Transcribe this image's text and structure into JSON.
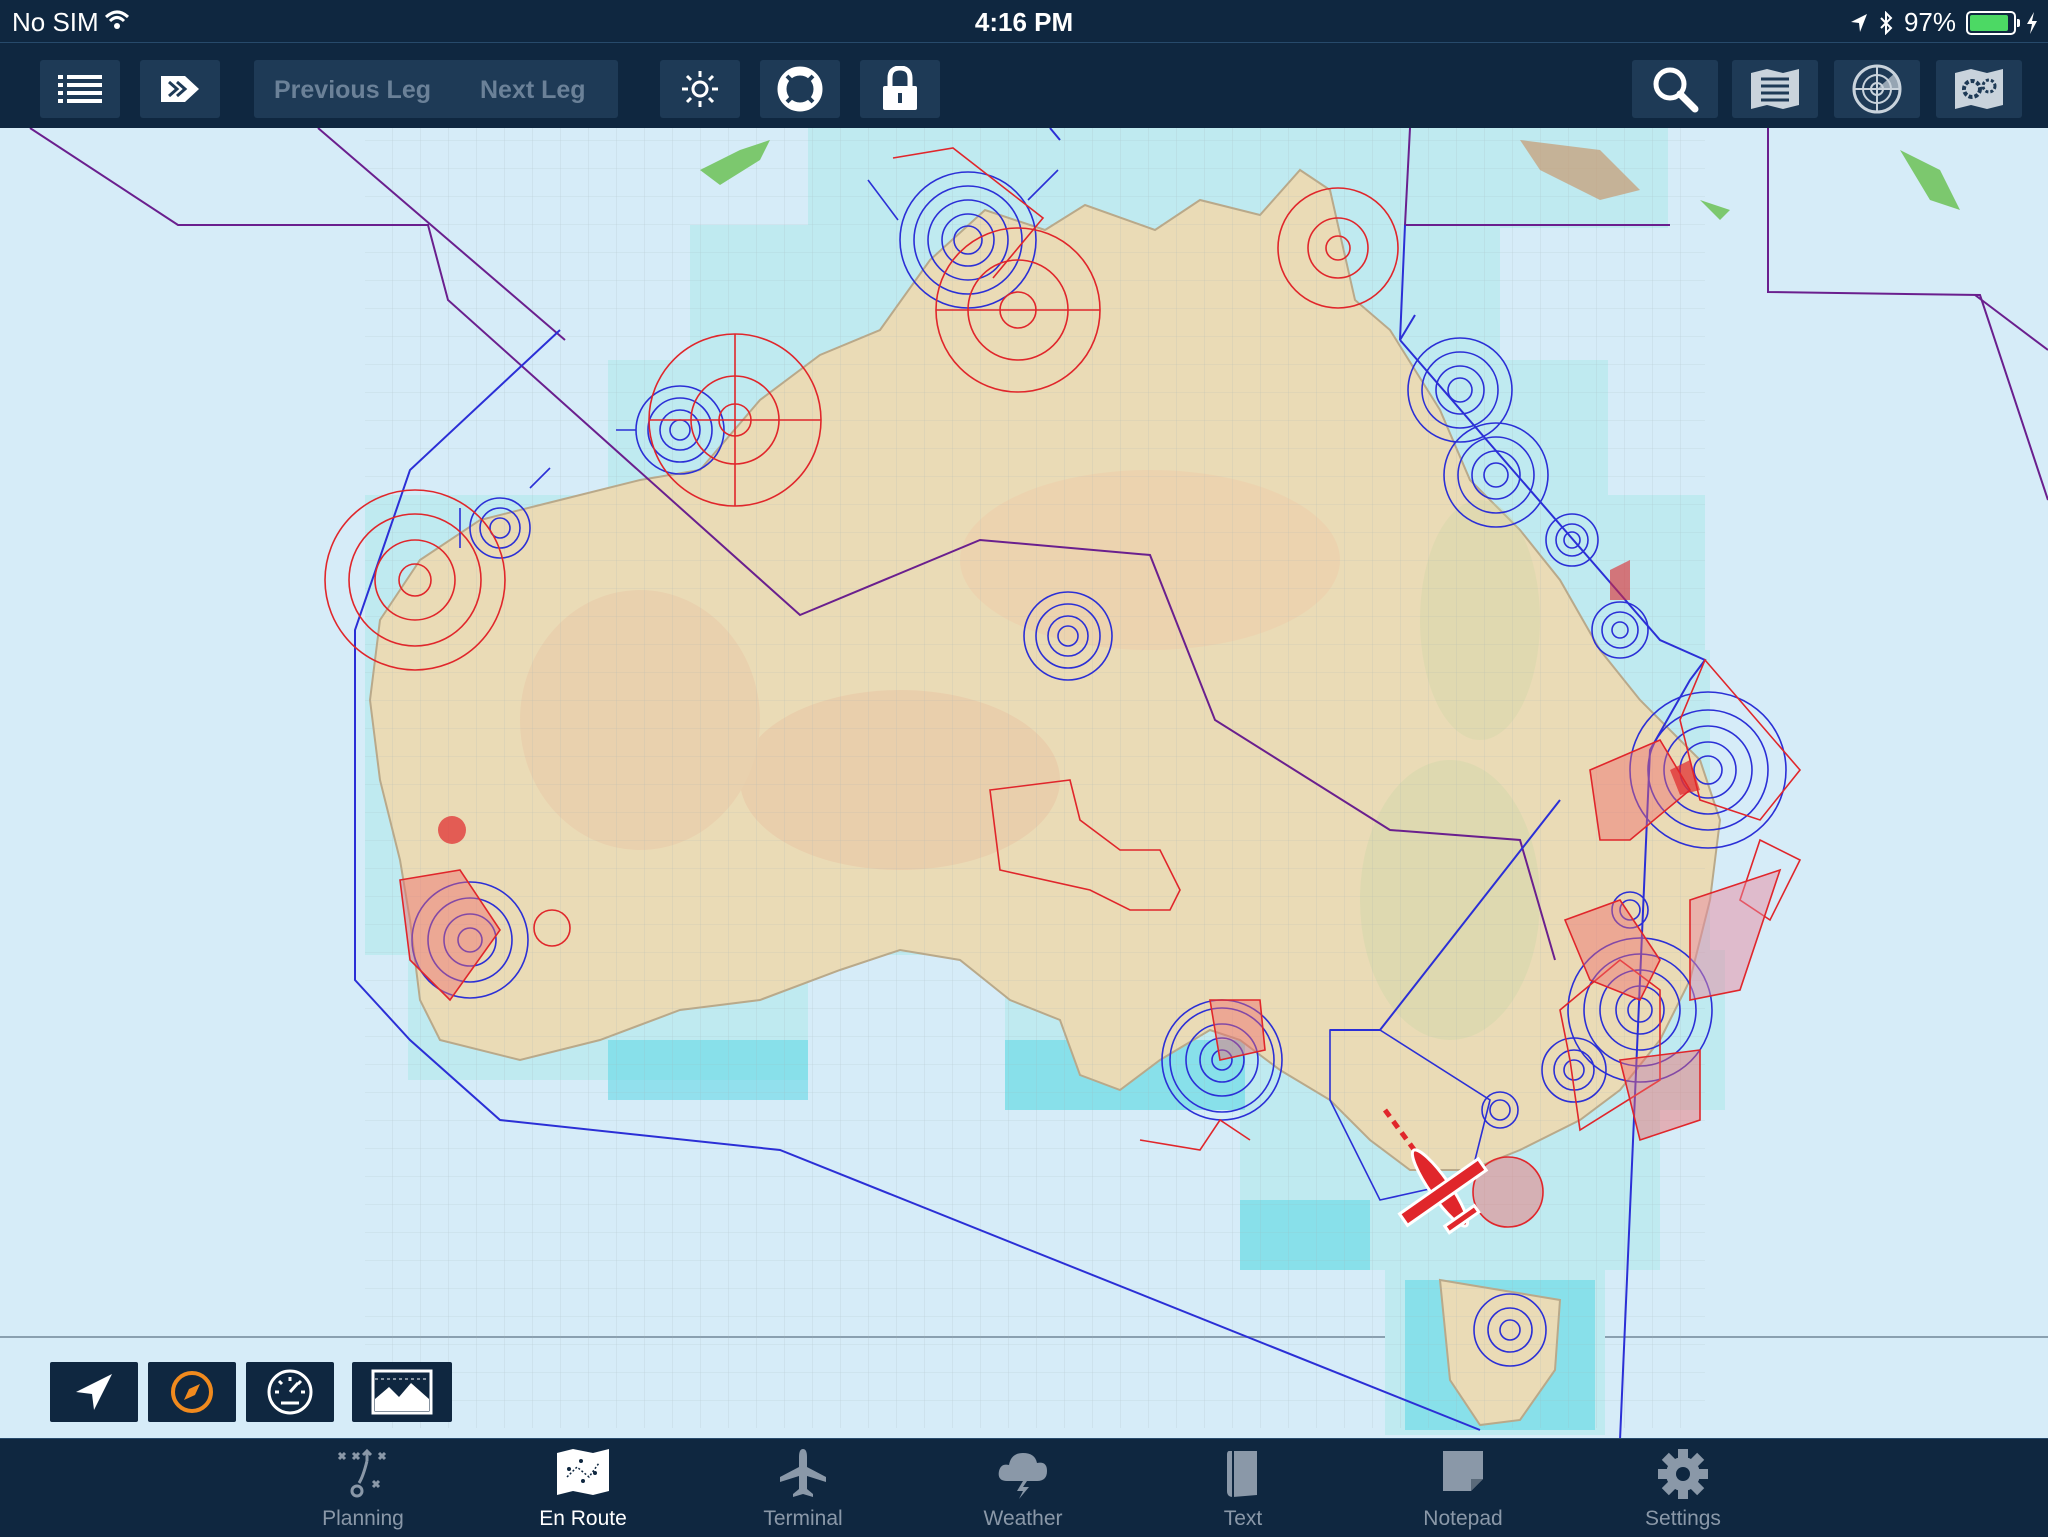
{
  "status_bar": {
    "carrier": "No SIM",
    "time": "4:16 PM",
    "battery": "97%"
  },
  "toolbar": {
    "previous_leg": "Previous Leg",
    "next_leg": "Next Leg",
    "icons": [
      "list-icon",
      "route-icon",
      "brightness-icon",
      "lifebuoy-icon",
      "lock-icon",
      "search-icon",
      "layers-icon",
      "radar-icon",
      "settings-icon"
    ]
  },
  "map": {
    "type": "Australian enroute chart with airspace overlays",
    "airspace_colors": {
      "controlled": "#2b2fd6",
      "restricted": "#e0262b",
      "fir_boundary": "#6a1f8e"
    }
  },
  "map_modes": [
    "locate-icon",
    "compass-icon",
    "gauge-icon",
    "terrain-profile-icon"
  ],
  "tabs": [
    {
      "label": "Planning",
      "active": false
    },
    {
      "label": "En Route",
      "active": true
    },
    {
      "label": "Terminal",
      "active": false
    },
    {
      "label": "Weather",
      "active": false
    },
    {
      "label": "Text",
      "active": false
    },
    {
      "label": "Notepad",
      "active": false
    },
    {
      "label": "Settings",
      "active": false
    }
  ]
}
